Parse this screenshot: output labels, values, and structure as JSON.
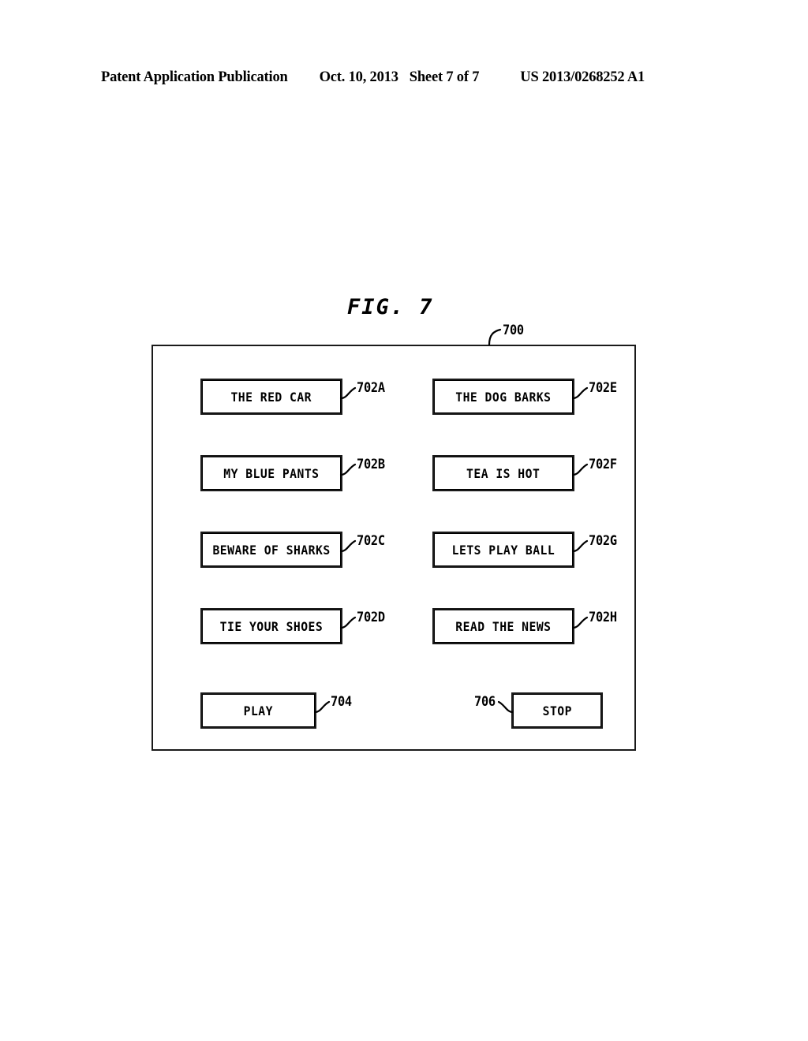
{
  "header": {
    "publication": "Patent Application Publication",
    "date": "Oct. 10, 2013",
    "sheet": "Sheet 7 of 7",
    "patent_number": "US 2013/0268252 A1"
  },
  "figure": {
    "title": "FIG. 7",
    "device_ref": "700"
  },
  "phrase_buttons": [
    {
      "label": "THE RED CAR",
      "ref": "702A",
      "column": "left",
      "row": 1
    },
    {
      "label": "MY BLUE PANTS",
      "ref": "702B",
      "column": "left",
      "row": 2
    },
    {
      "label": "BEWARE OF SHARKS",
      "ref": "702C",
      "column": "left",
      "row": 3
    },
    {
      "label": "TIE YOUR SHOES",
      "ref": "702D",
      "column": "left",
      "row": 4
    },
    {
      "label": "THE DOG BARKS",
      "ref": "702E",
      "column": "right",
      "row": 1
    },
    {
      "label": "TEA IS HOT",
      "ref": "702F",
      "column": "right",
      "row": 2
    },
    {
      "label": "LETS PLAY BALL",
      "ref": "702G",
      "column": "right",
      "row": 3
    },
    {
      "label": "READ THE NEWS",
      "ref": "702H",
      "column": "right",
      "row": 4
    }
  ],
  "transport_buttons": [
    {
      "label": "PLAY",
      "ref": "704"
    },
    {
      "label": "STOP",
      "ref": "706"
    }
  ],
  "colors": {
    "ink": "#000000",
    "frame": "#1a1a1a",
    "paper": "#ffffff"
  }
}
